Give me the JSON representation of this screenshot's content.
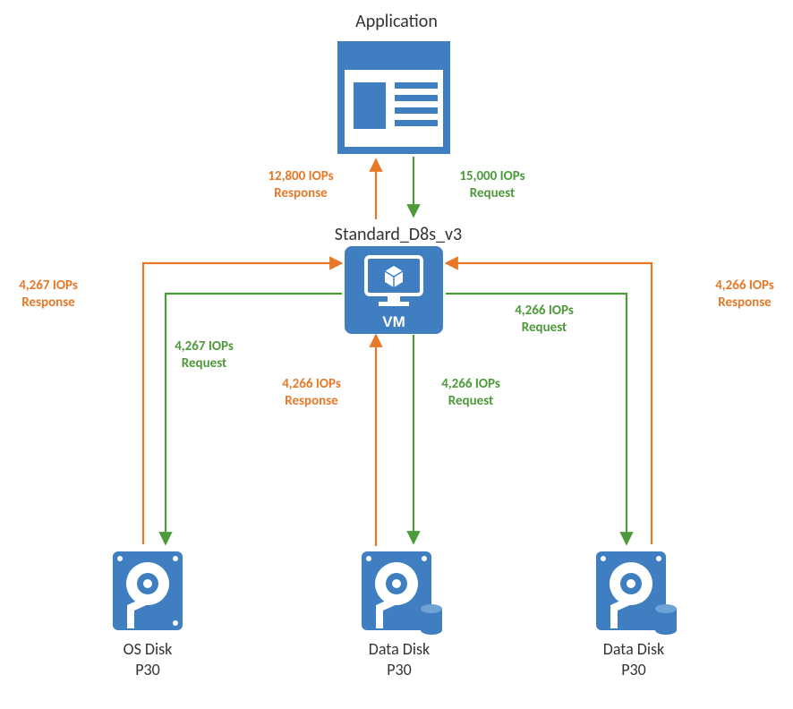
{
  "title_application": "Application",
  "title_vm": "Standard_D8s_v3",
  "vm_caption": "VM",
  "app_response": "12,800 IOPs\nResponse",
  "app_request": "15,000 IOPs\nRequest",
  "osdisk_response": "4,267 IOPs\nResponse",
  "osdisk_request": "4,267 IOPs\nRequest",
  "data1_response": "4,266 IOPs\nResponse",
  "data1_request": "4,266 IOPs\nRequest",
  "data2_response": "4,266 IOPs\nResponse",
  "data2_request": "4,266 IOPs\nRequest",
  "disk_os_name": "OS Disk",
  "disk_os_tier": "P30",
  "disk_d1_name": "Data Disk",
  "disk_d1_tier": "P30",
  "disk_d2_name": "Data Disk",
  "disk_d2_tier": "P30",
  "colors": {
    "blue": "#3f7fc1",
    "green": "#4c9a3a",
    "orange": "#e67828"
  }
}
